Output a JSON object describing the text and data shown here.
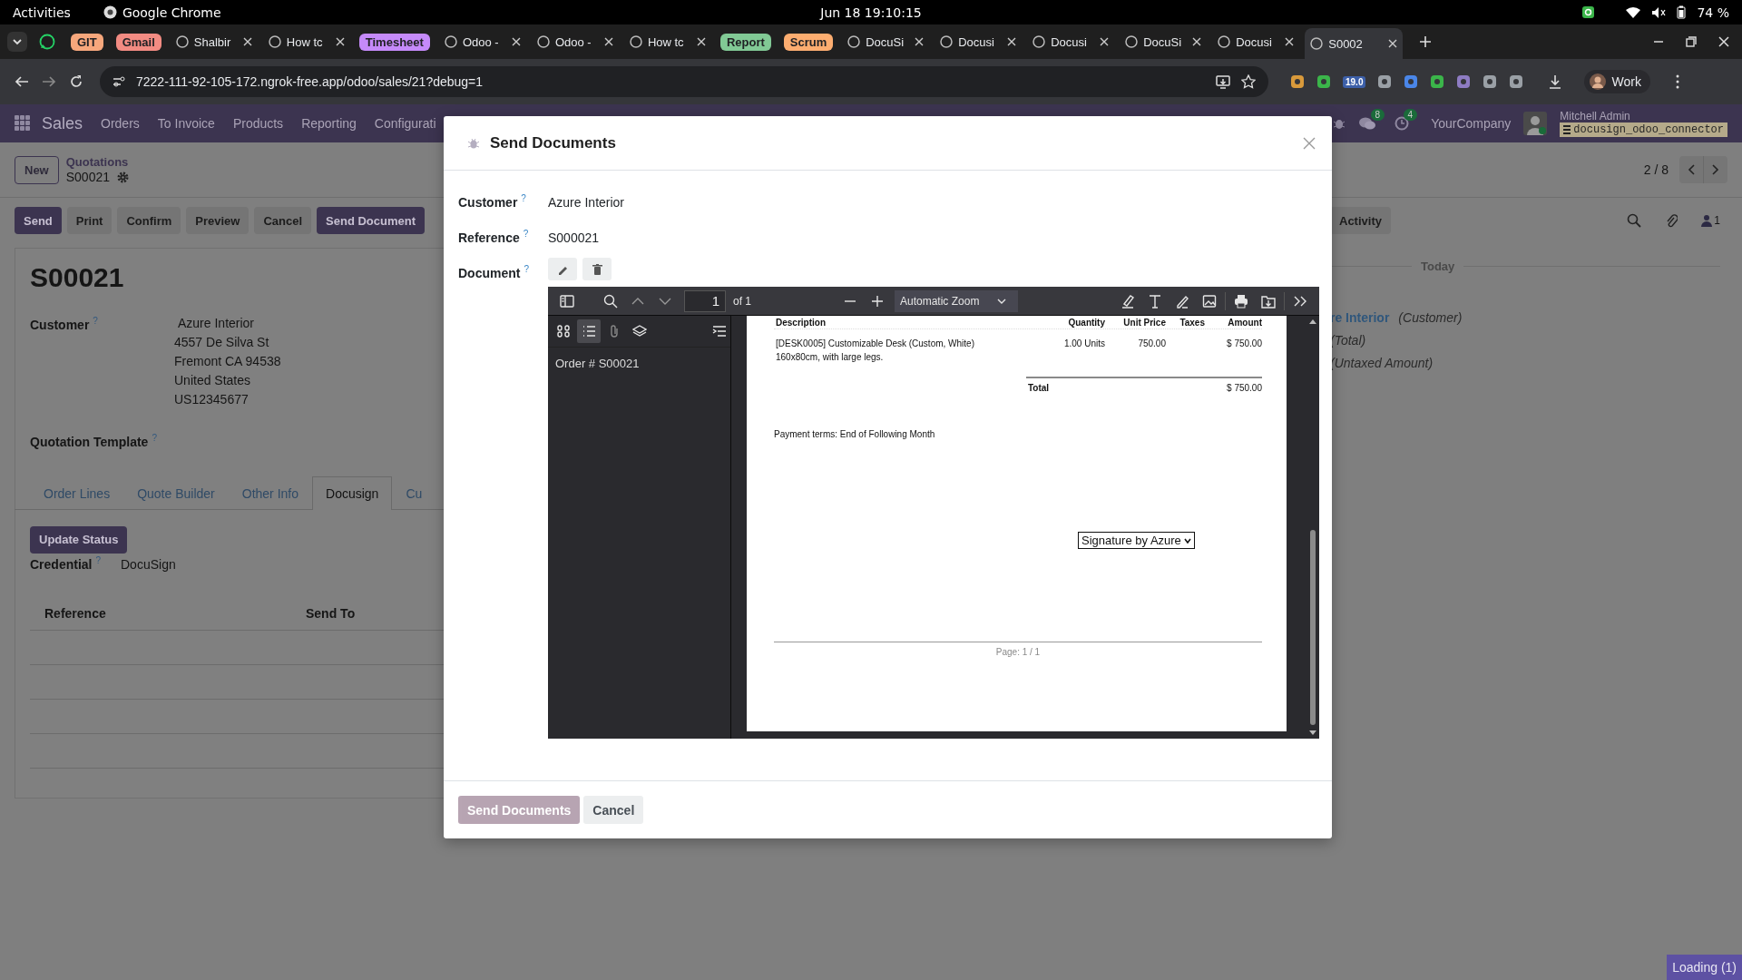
{
  "system_bar": {
    "activities": "Activities",
    "app_name": "Google Chrome",
    "clock": "Jun 18 19:10:15",
    "battery": "74 %"
  },
  "browser": {
    "tabs": [
      {
        "kind": "pinned",
        "selected": false
      },
      {
        "kind": "group",
        "label": "GIT",
        "color": "#f6a77c",
        "selected": false
      },
      {
        "kind": "group",
        "label": "Gmail",
        "color": "#f28b82",
        "selected": false
      },
      {
        "kind": "tab",
        "label": "Shalbir",
        "selected": false
      },
      {
        "kind": "tab",
        "label": "How tc",
        "selected": false
      },
      {
        "kind": "group",
        "label": "Timesheet",
        "color": "#c58af9",
        "selected": false
      },
      {
        "kind": "tab",
        "label": "Odoo -",
        "selected": false
      },
      {
        "kind": "tab",
        "label": "Odoo -",
        "selected": false
      },
      {
        "kind": "tab",
        "label": "How tc",
        "selected": false
      },
      {
        "kind": "group",
        "label": "Report",
        "color": "#81c995",
        "selected": false
      },
      {
        "kind": "group",
        "label": "Scrum",
        "color": "#fcad70",
        "selected": false
      },
      {
        "kind": "tab",
        "label": "DocuSi",
        "selected": false
      },
      {
        "kind": "tab",
        "label": "Docusi",
        "selected": false
      },
      {
        "kind": "tab",
        "label": "Docusi",
        "selected": false
      },
      {
        "kind": "tab",
        "label": "DocuSi",
        "selected": false
      },
      {
        "kind": "tab",
        "label": "Docusi",
        "selected": false
      },
      {
        "kind": "tab",
        "label": "S0002",
        "selected": true
      }
    ],
    "url": "7222-111-92-105-172.ngrok-free.app/odoo/sales/21?debug=1",
    "extension_badge": "19.0",
    "profile": "Work"
  },
  "odoo": {
    "app": "Sales",
    "menu": [
      "Orders",
      "To Invoice",
      "Products",
      "Reporting",
      "Configurati"
    ],
    "messages_count": "8",
    "activities_count": "4",
    "company": "YourCompany",
    "user": "Mitchell Admin",
    "database": "docusign_odoo_connector",
    "new_button": "New",
    "breadcrumb": "Quotations",
    "record": "S00021",
    "pager": "2 / 8",
    "actions": [
      {
        "label": "Send",
        "kind": "primary"
      },
      {
        "label": "Print",
        "kind": "secondary"
      },
      {
        "label": "Confirm",
        "kind": "secondary"
      },
      {
        "label": "Preview",
        "kind": "secondary"
      },
      {
        "label": "Cancel",
        "kind": "secondary"
      },
      {
        "label": "Send Document",
        "kind": "primary"
      }
    ],
    "sheet": {
      "title": "S00021",
      "customer": {
        "label": "Customer",
        "help": "?",
        "name": "Azure Interior",
        "address": [
          "4557 De Silva St",
          "Fremont CA 94538",
          "United States",
          "US12345677"
        ]
      },
      "template": {
        "label": "Quotation Template",
        "help": "?"
      },
      "tabs": [
        {
          "label": "Order Lines",
          "selected": false
        },
        {
          "label": "Quote Builder",
          "selected": false
        },
        {
          "label": "Other Info",
          "selected": false
        },
        {
          "label": "Docusign",
          "selected": true
        },
        {
          "label": "Cu",
          "selected": false
        }
      ],
      "update_button": "Update Status",
      "credential": {
        "label": "Credential",
        "help": "?",
        "value": "DocuSign"
      },
      "table": {
        "columns": [
          "Reference",
          "Send To"
        ]
      }
    },
    "chatter": {
      "activity_button": "Activity",
      "followers_count": "1",
      "separator": "Today",
      "lines": [
        {
          "name": "re Interior",
          "note": "(Customer)"
        },
        {
          "note": "(Total)"
        },
        {
          "note": "(Untaxed Amount)"
        }
      ]
    }
  },
  "modal": {
    "title": "Send Documents",
    "fields": [
      {
        "kind": "text",
        "label": "Customer",
        "help": "?",
        "value": "Azure Interior"
      },
      {
        "kind": "text",
        "label": "Reference",
        "help": "?",
        "value": "S000021"
      },
      {
        "kind": "document",
        "label": "Document",
        "help": "?",
        "viewer": {
          "page_number": "1",
          "page_count": "of 1",
          "zoom": "Automatic Zoom",
          "sidebar_views": [
            {
              "selected": false
            },
            {
              "selected": true
            },
            {
              "selected": false
            },
            {
              "selected": false
            }
          ],
          "outline": [
            "Order # S00021"
          ],
          "page": {
            "columns": [
              "Description",
              "Quantity",
              "Unit Price",
              "Taxes",
              "Amount"
            ],
            "lines": [
              {
                "description": "[DESK0005] Customizable Desk (Custom, White)\n160x80cm, with large legs.",
                "quantity": "1.00 Units",
                "unit_price": "750.00",
                "amount": "$ 750.00"
              }
            ],
            "total_label": "Total",
            "total": "$ 750.00",
            "payment_terms": "Payment terms: End of Following Month",
            "signature_field": "Signature by Azure",
            "footer": "Page: 1 / 1"
          }
        }
      }
    ],
    "buttons": [
      {
        "label": "Send Documents",
        "kind": "primary",
        "disabled": true
      },
      {
        "label": "Cancel",
        "kind": "secondary",
        "disabled": false
      }
    ]
  },
  "loading": "Loading (1)"
}
